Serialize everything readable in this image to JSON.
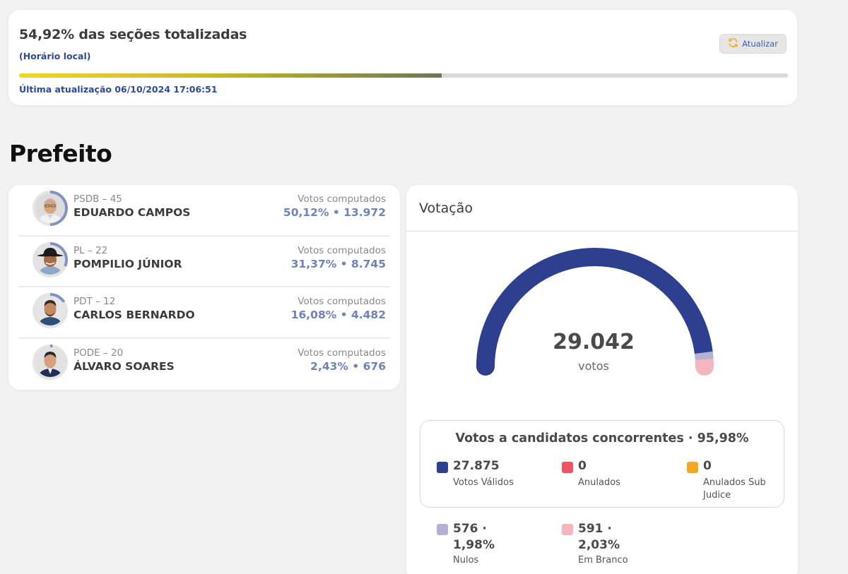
{
  "status": {
    "title": "54,92% das seções totalizadas",
    "subtitle": "(Horário local)",
    "progress_percent": 54.92,
    "updated": "Última atualização 06/10/2024 17:06:51",
    "refresh_label": "Atualizar",
    "colors": {
      "accent_blue": "#2c4a99",
      "progress_start": "#f0d81a",
      "progress_end": "#6e7656"
    }
  },
  "section_title": "Prefeito",
  "candidates": [
    {
      "party": "PSDB – 45",
      "name": "EDUARDO CAMPOS",
      "votes_label": "Votos computados",
      "votes": "50,12%  •  13.972",
      "share": 50.12
    },
    {
      "party": "PL – 22",
      "name": "POMPILIO JÚNIOR",
      "votes_label": "Votos computados",
      "votes": "31,37%  •  8.745",
      "share": 31.37
    },
    {
      "party": "PDT – 12",
      "name": "CARLOS BERNARDO",
      "votes_label": "Votos computados",
      "votes": "16,08%  •  4.482",
      "share": 16.08
    },
    {
      "party": "PODE – 20",
      "name": "ÁLVARO SOARES",
      "votes_label": "Votos computados",
      "votes": "2,43%  •  676",
      "share": 2.43
    }
  ],
  "votacao": {
    "title": "Votação",
    "total": "29.042",
    "total_label": "votos",
    "gauge_segments": [
      {
        "name": "Votos Válidos",
        "value": 27875,
        "color": "#2f3f8f"
      },
      {
        "name": "Nulos",
        "value": 576,
        "color": "#b5b1d6"
      },
      {
        "name": "Em Branco",
        "value": 591,
        "color": "#f6b6c0"
      }
    ],
    "competing_title": "Votos a candidatos concorrentes · 95,98%",
    "stats": [
      {
        "value": "27.875",
        "label": "Votos Válidos",
        "color": "#2f3f8f"
      },
      {
        "value": "0",
        "label": "Anulados",
        "color": "#f0525f"
      },
      {
        "value": "0",
        "label": "Anulados Sub Judice",
        "color": "#f5a623"
      }
    ],
    "extra": [
      {
        "value": "576 · 1,98%",
        "label": "Nulos",
        "color": "#b5b1d6"
      },
      {
        "value": "591 · 2,03%",
        "label": "Em Branco",
        "color": "#f6b6c0"
      }
    ]
  }
}
